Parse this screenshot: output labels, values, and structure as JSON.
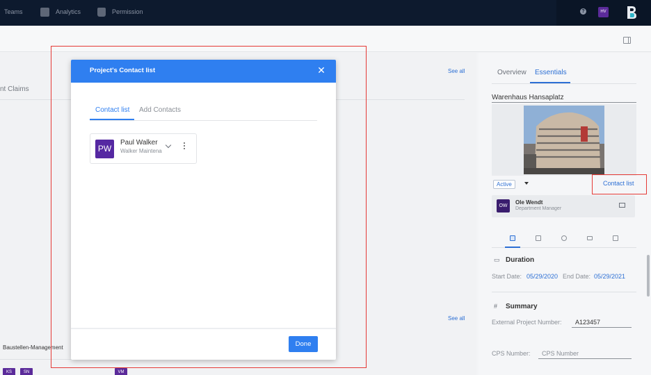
{
  "nav": {
    "items": [
      {
        "label": "Teams",
        "icon": "teams-icon"
      },
      {
        "label": "Analytics",
        "icon": "analytics-icon"
      },
      {
        "label": "Permission",
        "icon": "lock-icon"
      }
    ],
    "help_icon": "help-icon",
    "user_initials": "HV",
    "logo": "brand-logo"
  },
  "background": {
    "claims_fragment": "nt Claims",
    "see_all_top": "See all",
    "see_all_bottom": "See all",
    "group_label": "Baustellen-Management",
    "chips": [
      "KS",
      "SN",
      "VM"
    ]
  },
  "right_panel": {
    "tabs": [
      "Overview",
      "Essentials"
    ],
    "active_tab": "Essentials",
    "project_name": "Warenhaus Hansaplatz",
    "status": "Active",
    "contact_list_link": "Contact list",
    "manager": {
      "initials": "OW",
      "name": "Ole Wendt",
      "role": "Department Manager"
    },
    "duration": {
      "heading": "Duration",
      "start_label": "Start Date:",
      "start_value": "05/29/2020",
      "end_label": "End Date:",
      "end_value": "05/29/2021"
    },
    "summary": {
      "heading": "Summary",
      "external_label": "External Project Number:",
      "external_value": "A123457",
      "cps_label": "CPS Number:",
      "cps_placeholder": "CPS Number"
    }
  },
  "modal": {
    "title": "Project's Contact list",
    "tabs": [
      "Contact list",
      "Add Contacts"
    ],
    "active_tab": "Contact list",
    "contacts": [
      {
        "initials": "PW",
        "name": "Paul Walker",
        "company": "Walker Maintena"
      }
    ],
    "done_label": "Done"
  },
  "colors": {
    "accent": "#2f7ff0",
    "navbar": "#0d1a2e",
    "avatar": "#5528a2",
    "highlight": "#e53935"
  }
}
